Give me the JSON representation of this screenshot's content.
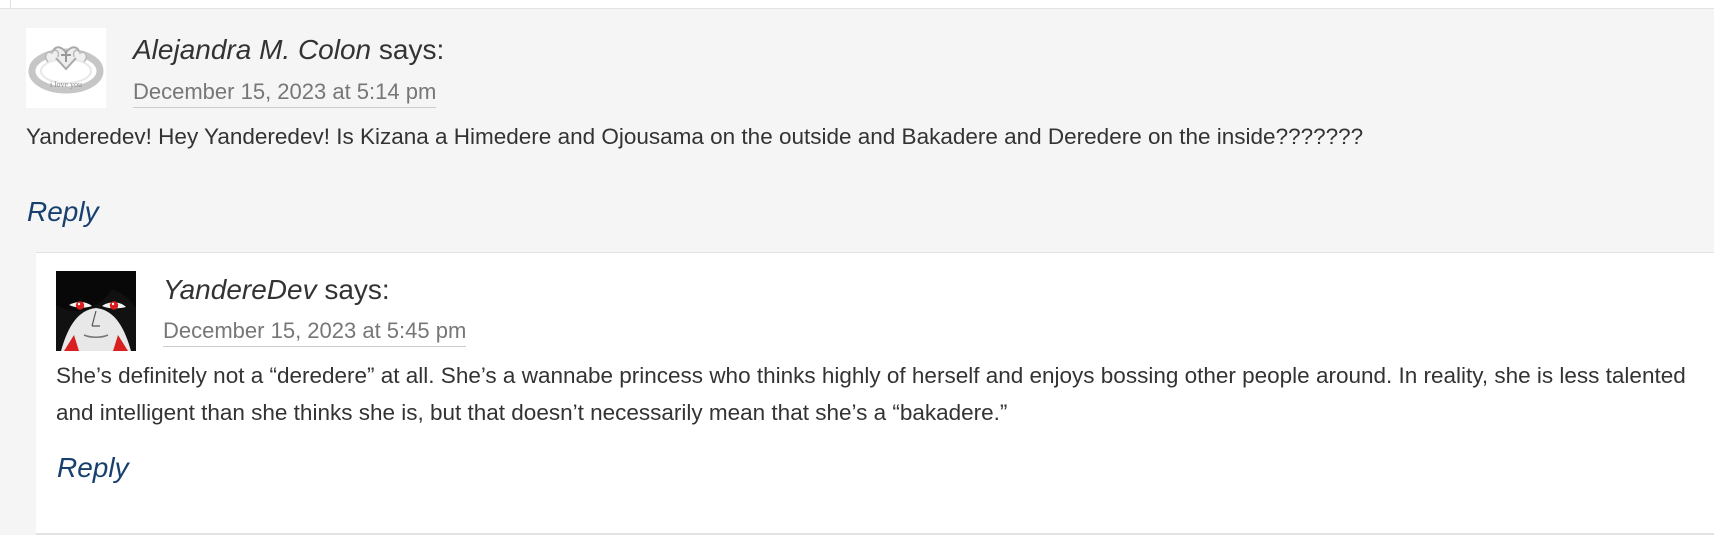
{
  "comments": [
    {
      "author": "Alejandra M. Colon",
      "says": "says:",
      "date": "December 15, 2023 at 5:14 pm",
      "text": "Yanderedev! Hey Yanderedev! Is Kizana a Himedere and Ojousama on the outside and Bakadere and Deredere on the inside???????",
      "reply_label": "Reply",
      "avatar_icon": "heart-ring-avatar-icon",
      "avatar_engraving": "i love you"
    },
    {
      "author": "YandereDev",
      "says": "says:",
      "date": "December 15, 2023 at 5:45 pm",
      "text": "She’s definitely not a “deredere” at all. She’s a wannabe princess who thinks highly of herself and enjoys bossing other people around. In reality, she is less talented and intelligent than she thinks she is, but that doesn’t necessarily mean that she’s a “bakadere.”",
      "reply_label": "Reply",
      "avatar_icon": "anime-character-avatar-icon"
    }
  ],
  "colors": {
    "parent_background": "#f5f5f5",
    "child_background": "#ffffff",
    "reply_link": "#18406e",
    "date_text": "#777777",
    "border": "#e2e2e2"
  }
}
